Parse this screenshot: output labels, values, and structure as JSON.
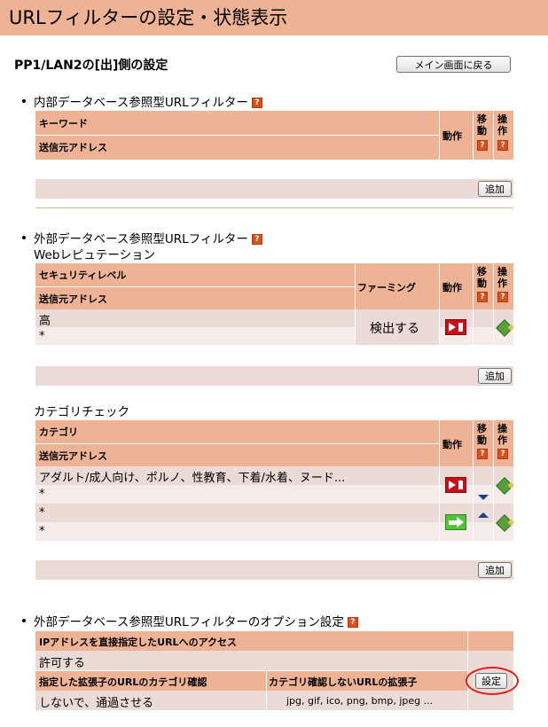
{
  "page_title": "URLフィルターの設定・状態表示",
  "section_title": "PP1/LAN2の[出]側の設定",
  "main_button": "メイン画面に戻る",
  "help_glyph": "?",
  "add_label": "追加",
  "internal": {
    "title": "内部データベース参照型URLフィルター",
    "headers": {
      "keyword": "キーワード",
      "source": "送信元アドレス",
      "action": "動作",
      "move": "移動",
      "op": "操作"
    }
  },
  "external": {
    "title": "外部データベース参照型URLフィルター",
    "web_rep": {
      "subtitle": "Webレピュテーション",
      "headers": {
        "security": "セキュリティレベル",
        "source": "送信元アドレス",
        "pharming": "ファーミング",
        "action": "動作",
        "move": "移動",
        "op": "操作"
      },
      "row": {
        "level": "高",
        "source": "*",
        "pharming": "検出する"
      }
    },
    "category": {
      "subtitle": "カテゴリチェック",
      "headers": {
        "category": "カテゴリ",
        "source": "送信元アドレス",
        "action": "動作",
        "move": "移動",
        "op": "操作"
      },
      "rows": [
        {
          "category": "アダルト/成人向け、ポルノ、性教育、下着/水着、ヌード...",
          "source": "*",
          "action": "reject"
        },
        {
          "category": "*",
          "source": "*",
          "action": "pass"
        }
      ]
    }
  },
  "options": {
    "title": "外部データベース参照型URLフィルターのオプション設定",
    "ip_header": "IPアドレスを直接指定したURLへのアクセス",
    "ip_value": "許可する",
    "ext_header": "指定した拡張子のURLのカテゴリ確認",
    "ext_value": "しないで、通過させる",
    "noext_header": "カテゴリ確認しないURLの拡張子",
    "noext_value": "jpg, gif, ico, png, bmp, jpeg ...",
    "set_button": "設定"
  },
  "colors": {
    "header": "#eeb395",
    "row": "#ebdbd7",
    "highlight": "#e0201a"
  }
}
